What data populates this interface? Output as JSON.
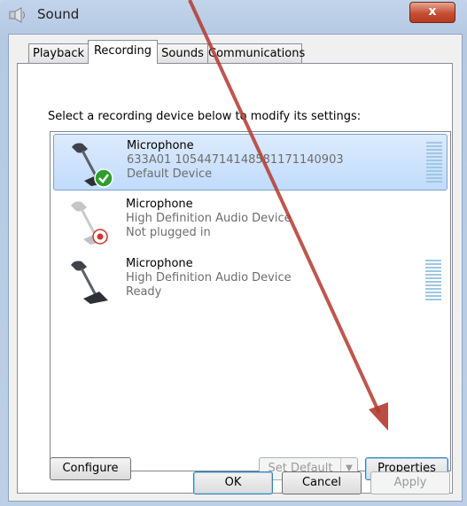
{
  "window": {
    "title": "Sound",
    "close_label": "x"
  },
  "tabs": [
    {
      "label": "Playback"
    },
    {
      "label": "Recording"
    },
    {
      "label": "Sounds"
    },
    {
      "label": "Communications"
    }
  ],
  "instruction": "Select a recording device below to modify its settings:",
  "devices": [
    {
      "name": "Microphone",
      "line1": "633A01 10544714148581171140903",
      "line2": "Default Device",
      "status": "default",
      "selected": true
    },
    {
      "name": "Microphone",
      "line1": "High Definition Audio Device",
      "line2": "Not plugged in",
      "status": "unplugged",
      "selected": false
    },
    {
      "name": "Microphone",
      "line1": "High Definition Audio Device",
      "line2": "Ready",
      "status": "ready",
      "selected": false
    }
  ],
  "buttons": {
    "configure": "Configure",
    "set_default": "Set Default",
    "properties": "Properties",
    "ok": "OK",
    "cancel": "Cancel",
    "apply": "Apply"
  },
  "colors": {
    "selection": "#c1dbfc",
    "annotation_arrow": "#b33a30",
    "default_check": "#2f9d2f",
    "unplugged_badge": "#d0342c"
  }
}
